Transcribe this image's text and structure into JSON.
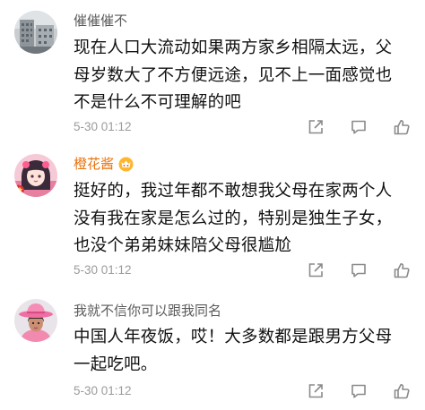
{
  "comments": [
    {
      "username": "催催催不",
      "vip": false,
      "lines": [
        "现在人口大流动如果两方家乡相隔太远，父",
        "母岁数大了不方便远途，见不上一面感觉也",
        "不是什么不可理解的吧"
      ],
      "time": "5-30 01:12",
      "avatar_icon": "avatar-building-photo"
    },
    {
      "username": "橙花酱",
      "vip": true,
      "badge_icon": "vip-crown-icon",
      "lines": [
        "挺好的，我过年都不敢想我父母在家两个人",
        "没有我在家是怎么过的，特别是独生子女，",
        "也没个弟弟妹妹陪父母很尴尬"
      ],
      "time": "5-30 01:12",
      "avatar_icon": "avatar-anime-girl-pink"
    },
    {
      "username": "我就不信你可以跟我同名",
      "vip": false,
      "lines": [
        "中国人年夜饭，哎！大多数都是跟男方父母",
        "一起吃吧。"
      ],
      "time": "5-30 01:12",
      "avatar_icon": "avatar-woman-pink-hat"
    }
  ],
  "actions": [
    "share-icon",
    "comment-icon",
    "like-icon"
  ],
  "colors": {
    "username": "#5b5b5b",
    "vip_username": "#e8720c",
    "content": "#111111",
    "meta": "#9b9b9b",
    "icon": "#8a8a8a"
  }
}
